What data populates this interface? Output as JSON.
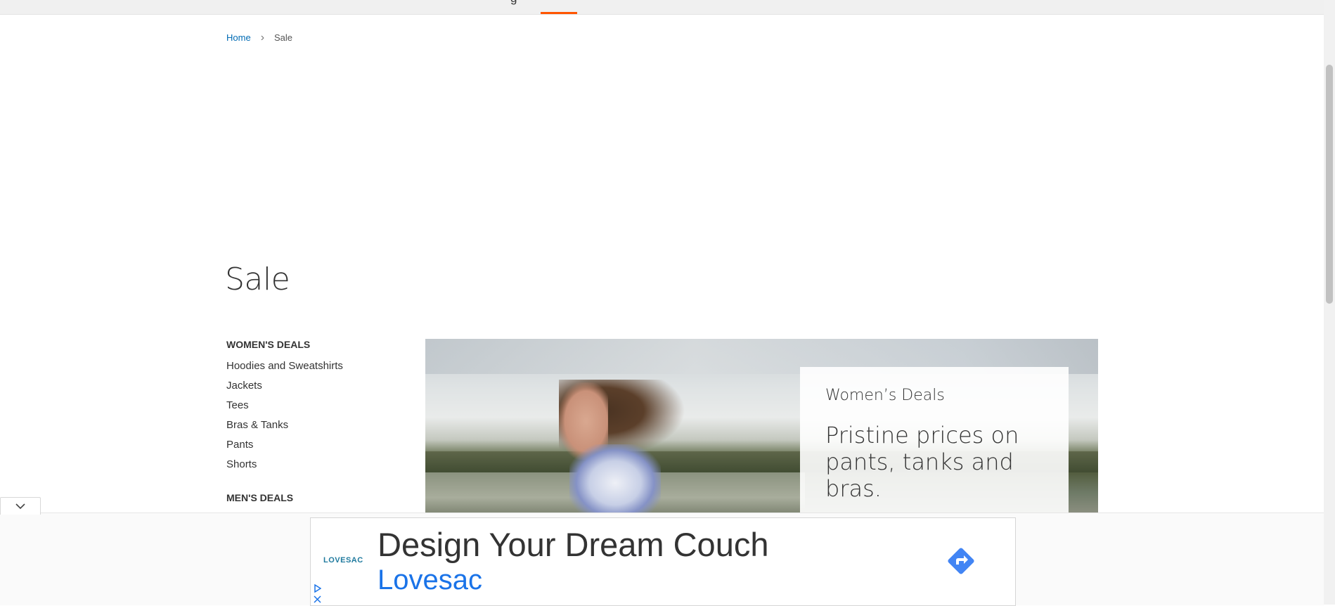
{
  "topnav": {
    "clipped_label": "g"
  },
  "breadcrumb": {
    "home": "Home",
    "separator": "›",
    "current": "Sale"
  },
  "page": {
    "title": "Sale"
  },
  "sidebar": {
    "womens_heading": "WOMEN'S DEALS",
    "womens_items": [
      {
        "label": "Hoodies and Sweatshirts"
      },
      {
        "label": "Jackets"
      },
      {
        "label": "Tees"
      },
      {
        "label": "Bras & Tanks"
      },
      {
        "label": "Pants"
      },
      {
        "label": "Shorts"
      }
    ],
    "mens_heading": "MEN'S DEALS"
  },
  "hero": {
    "eyebrow": "Women’s Deals",
    "headline": "Pristine prices on pants, tanks and bras."
  },
  "ad": {
    "logo": "LOVESAC",
    "headline": "Design Your Dream Couch",
    "brand": "Lovesac",
    "collapse_icon": "chevron-down-icon",
    "cta_icon": "directions-arrow-icon",
    "cta_color": "#4285f4",
    "adchoices_icon": "adchoices-icon",
    "close_icon": "close-icon"
  },
  "colors": {
    "accent": "#ff5501",
    "link": "#006bb4",
    "ad_brand": "#1a73e8"
  }
}
